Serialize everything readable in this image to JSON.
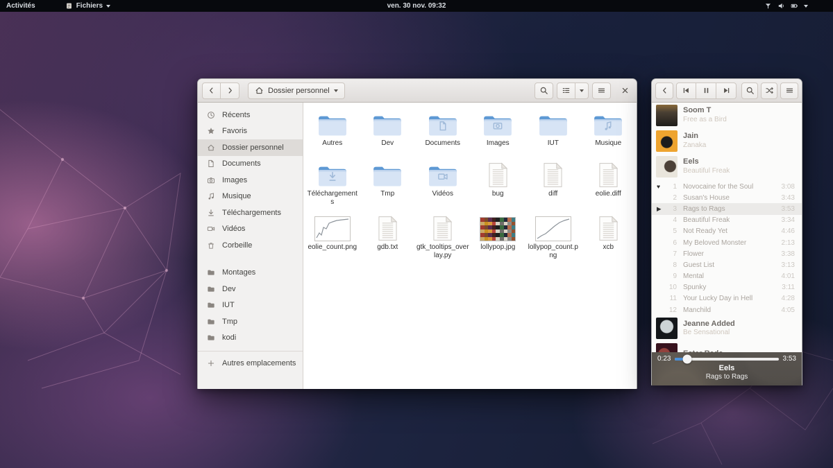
{
  "topbar": {
    "activities": "Activités",
    "app_menu": "Fichiers",
    "clock": "ven. 30 nov. 09:32"
  },
  "files_window": {
    "path_button": "Dossier personnel",
    "sidebar": {
      "items": [
        {
          "label": "Récents",
          "icon": "clock"
        },
        {
          "label": "Favoris",
          "icon": "star"
        },
        {
          "label": "Dossier personnel",
          "icon": "home",
          "selected": true
        },
        {
          "label": "Documents",
          "icon": "doc"
        },
        {
          "label": "Images",
          "icon": "camera"
        },
        {
          "label": "Musique",
          "icon": "note"
        },
        {
          "label": "Téléchargements",
          "icon": "down"
        },
        {
          "label": "Vidéos",
          "icon": "video"
        },
        {
          "label": "Corbeille",
          "icon": "trash"
        }
      ],
      "mounts": [
        {
          "label": "Montages",
          "icon": "folder"
        },
        {
          "label": "Dev",
          "icon": "folder"
        },
        {
          "label": "IUT",
          "icon": "folder"
        },
        {
          "label": "Tmp",
          "icon": "folder"
        },
        {
          "label": "kodi",
          "icon": "folder"
        }
      ],
      "other_locations": "Autres emplacements"
    },
    "files": [
      {
        "name": "Autres",
        "type": "folder"
      },
      {
        "name": "Dev",
        "type": "folder"
      },
      {
        "name": "Documents",
        "type": "folder",
        "emblem": "doc"
      },
      {
        "name": "Images",
        "type": "folder",
        "emblem": "camera"
      },
      {
        "name": "IUT",
        "type": "folder"
      },
      {
        "name": "Musique",
        "type": "folder",
        "emblem": "note"
      },
      {
        "name": "Téléchargements",
        "type": "folder",
        "emblem": "down"
      },
      {
        "name": "Tmp",
        "type": "folder"
      },
      {
        "name": "Vidéos",
        "type": "folder",
        "emblem": "video"
      },
      {
        "name": "bug",
        "type": "text"
      },
      {
        "name": "diff",
        "type": "text"
      },
      {
        "name": "eolie.diff",
        "type": "text"
      },
      {
        "name": "eolie_count.png",
        "type": "chart"
      },
      {
        "name": "gdb.txt",
        "type": "text"
      },
      {
        "name": "gtk_tooltips_overlay.py",
        "type": "text"
      },
      {
        "name": "lollypop.jpg",
        "type": "mosaic"
      },
      {
        "name": "lollypop_count.png",
        "type": "chart2"
      },
      {
        "name": "xcb",
        "type": "text"
      }
    ],
    "folder_colors": {
      "tab": "#5e99d4",
      "body": "#d7e4f5"
    }
  },
  "player_window": {
    "artists_top": [
      {
        "name": "Soom T",
        "album": "Free as a Bird",
        "art": "soomt"
      },
      {
        "name": "Jain",
        "album": "Zanaka",
        "art": "jain"
      },
      {
        "name": "Eels",
        "album": "Beautiful Freak",
        "art": "eels"
      }
    ],
    "tracks": [
      {
        "num": "1",
        "title": "Novocaine for the Soul",
        "duration": "3:08",
        "favorite": true
      },
      {
        "num": "2",
        "title": "Susan's House",
        "duration": "3:43"
      },
      {
        "num": "3",
        "title": "Rags to Rags",
        "duration": "3:53",
        "playing": true
      },
      {
        "num": "4",
        "title": "Beautiful Freak",
        "duration": "3:34"
      },
      {
        "num": "5",
        "title": "Not Ready Yet",
        "duration": "4:46"
      },
      {
        "num": "6",
        "title": "My Beloved Monster",
        "duration": "2:13"
      },
      {
        "num": "7",
        "title": "Flower",
        "duration": "3:38"
      },
      {
        "num": "8",
        "title": "Guest List",
        "duration": "3:13"
      },
      {
        "num": "9",
        "title": "Mental",
        "duration": "4:01"
      },
      {
        "num": "10",
        "title": "Spunky",
        "duration": "3:11"
      },
      {
        "num": "11",
        "title": "Your Lucky Day in Hell",
        "duration": "4:28"
      },
      {
        "num": "12",
        "title": "Manchild",
        "duration": "4:05"
      }
    ],
    "artists_bottom": [
      {
        "name": "Jeanne Added",
        "album": "Be Sensational",
        "art": "jeanne"
      },
      {
        "name": "Ester Rada",
        "album": "",
        "art": "ester"
      }
    ],
    "progress": {
      "elapsed": "0:23",
      "total": "3:53",
      "percent": 12
    },
    "now_playing": {
      "artist": "Eels",
      "title": "Rags to Rags"
    },
    "accent_color": "#4a90d9"
  }
}
